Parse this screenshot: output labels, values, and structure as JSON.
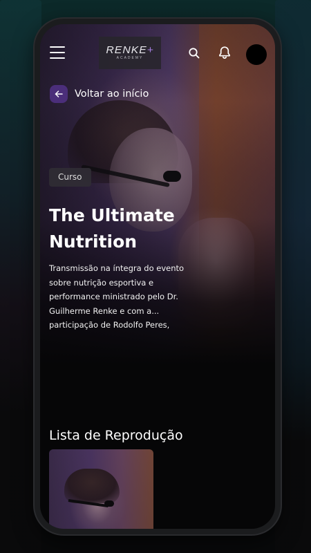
{
  "header": {
    "logo_text": "RENKE",
    "logo_plus": "+",
    "logo_subtext": "ACADEMY"
  },
  "back": {
    "label": "Voltar ao início"
  },
  "course": {
    "badge": "Curso",
    "title": "The Ultimate Nutrition",
    "description": "Transmissão na íntegra do evento sobre nutrição esportiva e performance ministrado pelo Dr. Guilherme Renke e com a... participação de Rodolfo Peres,"
  },
  "playlist": {
    "section_title": "Lista de Reprodução"
  },
  "icons": {
    "menu": "menu-icon",
    "search": "search-icon",
    "notifications": "bell-icon",
    "back": "arrow-left-icon"
  },
  "colors": {
    "accent": "#4b2e7a",
    "logo_plus": "#a57fe0",
    "background": "#060607"
  }
}
